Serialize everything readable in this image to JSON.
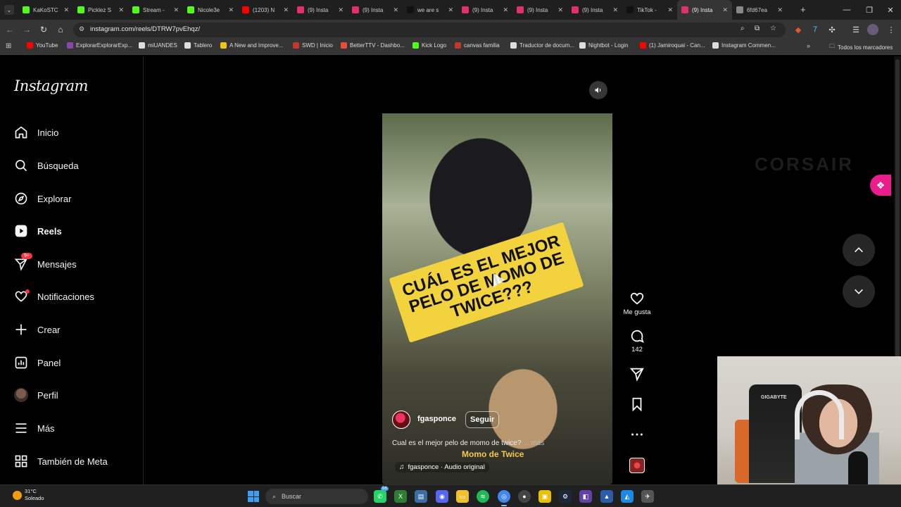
{
  "browser": {
    "tabs": [
      {
        "title": "KaKoSTC",
        "icon": "kick-icon",
        "color": "#53fc18"
      },
      {
        "title": "Picklez S",
        "icon": "kick-icon",
        "color": "#53fc18"
      },
      {
        "title": "Stream -",
        "icon": "kick-icon",
        "color": "#53fc18"
      },
      {
        "title": "Nicole3e",
        "icon": "kick-icon",
        "color": "#53fc18"
      },
      {
        "title": "(1203) N",
        "icon": "youtube-icon",
        "color": "#ff0000"
      },
      {
        "title": "(9) Insta",
        "icon": "instagram-icon",
        "color": "#e1306c"
      },
      {
        "title": "(9) Insta",
        "icon": "instagram-icon",
        "color": "#e1306c"
      },
      {
        "title": "we are s",
        "icon": "tiktok-icon",
        "color": "#111111"
      },
      {
        "title": "(9) Insta",
        "icon": "instagram-icon",
        "color": "#e1306c"
      },
      {
        "title": "(9) Insta",
        "icon": "instagram-icon",
        "color": "#e1306c"
      },
      {
        "title": "(9) Insta",
        "icon": "instagram-icon",
        "color": "#e1306c"
      },
      {
        "title": "TikTok -",
        "icon": "tiktok-icon",
        "color": "#111111"
      },
      {
        "title": "(9) Insta",
        "icon": "instagram-icon",
        "color": "#e1306c",
        "active": true
      },
      {
        "title": "6fd67ea",
        "icon": "globe-icon",
        "color": "#888888"
      }
    ],
    "new_tab": "+",
    "url": "instagram.com/reels/DTRW7pvEhqz/",
    "bookmarks": [
      {
        "label": "YouTube",
        "color": "#ff0000"
      },
      {
        "label": "ExplorarExplorarExp...",
        "color": "#8e44ad"
      },
      {
        "label": "miUANDES",
        "color": "#dddddd"
      },
      {
        "label": "Tablero",
        "color": "#dddddd"
      },
      {
        "label": "A New and Improve...",
        "color": "#f1c40f"
      },
      {
        "label": "SWD | Inicio",
        "color": "#c0392b"
      },
      {
        "label": "BetterTTV - Dashbo...",
        "color": "#e74c3c"
      },
      {
        "label": "Kick Logo",
        "color": "#53fc18"
      },
      {
        "label": "canvas familia",
        "color": "#c0392b"
      },
      {
        "label": "Traductor de docum...",
        "color": "#dddddd"
      },
      {
        "label": "Nightbot - Login",
        "color": "#dddddd"
      },
      {
        "label": "(1) Jamiroquai - Can...",
        "color": "#ff0000"
      },
      {
        "label": "Instagram Commen...",
        "color": "#dddddd"
      }
    ],
    "all_bookmarks": "Todos los marcadores"
  },
  "sidebar": {
    "logo": "Instagram",
    "items": [
      {
        "label": "Inicio",
        "icon": "home-icon"
      },
      {
        "label": "Búsqueda",
        "icon": "search-icon"
      },
      {
        "label": "Explorar",
        "icon": "compass-icon"
      },
      {
        "label": "Reels",
        "icon": "reels-icon"
      },
      {
        "label": "Mensajes",
        "icon": "messenger-icon",
        "badge": "9+"
      },
      {
        "label": "Notificaciones",
        "icon": "heart-icon"
      },
      {
        "label": "Crear",
        "icon": "plus-icon"
      },
      {
        "label": "Panel",
        "icon": "dashboard-icon"
      },
      {
        "label": "Perfil",
        "icon": "profile-avatar"
      },
      {
        "label": "Más",
        "icon": "menu-icon"
      },
      {
        "label": "También de Meta",
        "icon": "meta-icon"
      }
    ]
  },
  "reel": {
    "sticker_text": "CUÁL ES EL MEJOR PELO DE MOMO DE TWICE???",
    "username": "fgasponce",
    "follow_label": "Seguir",
    "caption": "Cual es el mejor pelo de momo de twice?",
    "caption_more": "... más",
    "overlay_text": "Momo de Twice",
    "audio": "fgasponce · Audio original"
  },
  "actions": {
    "like_label": "Me gusta",
    "comments_count": "142"
  },
  "watermark": "CORSAIR",
  "webcam": {
    "chair_brand": "GIGABYTE"
  },
  "taskbar": {
    "temperature": "31°C",
    "weather": "Soleado",
    "search_placeholder": "Buscar",
    "whatsapp_badge": "56"
  }
}
